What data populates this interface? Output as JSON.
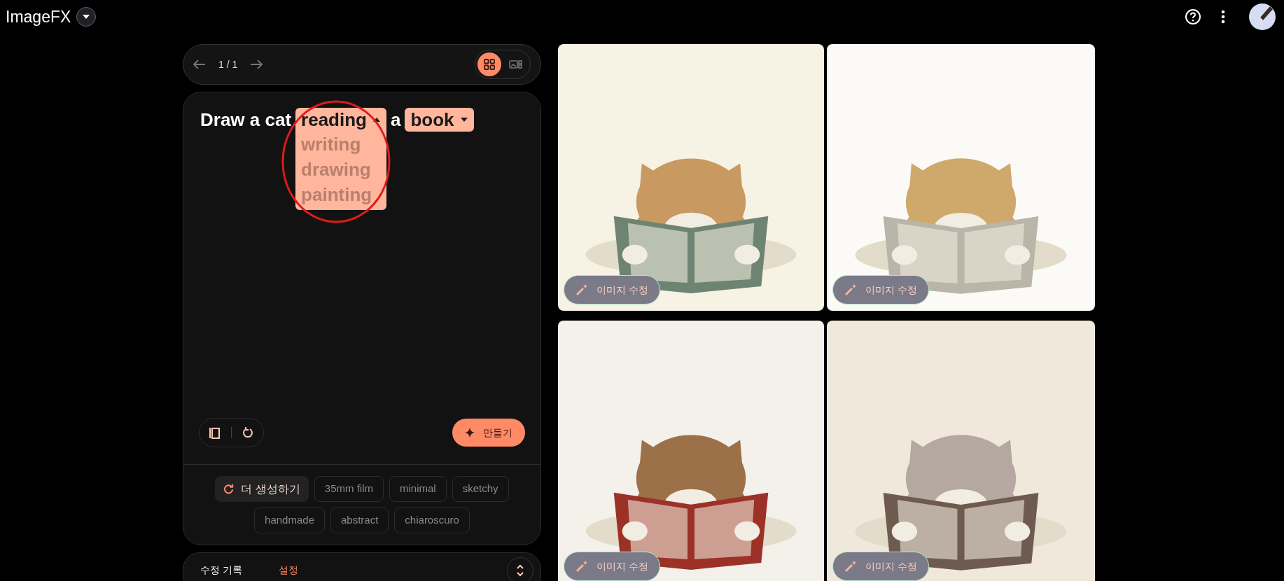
{
  "app": {
    "title": "ImageFX"
  },
  "pager": {
    "label": "1 / 1",
    "views": [
      {
        "kind": "grid",
        "selected": true
      },
      {
        "kind": "single",
        "selected": false
      }
    ]
  },
  "prompt": {
    "segments": [
      {
        "kind": "text",
        "text": "Draw a cat"
      },
      {
        "kind": "chip",
        "text": "reading",
        "expanded": true,
        "options": [
          "writing",
          "drawing",
          "painting"
        ]
      },
      {
        "kind": "text",
        "text": "a"
      },
      {
        "kind": "chip",
        "text": "book",
        "expanded": false
      }
    ]
  },
  "create_button": "만들기",
  "suggestions": [
    {
      "kind": "refresh",
      "label": "더 생성하기"
    },
    {
      "kind": "chip",
      "label": "35mm film"
    },
    {
      "kind": "chip",
      "label": "minimal"
    },
    {
      "kind": "chip",
      "label": "sketchy"
    },
    {
      "kind": "chip",
      "label": "handmade"
    },
    {
      "kind": "chip",
      "label": "abstract"
    },
    {
      "kind": "chip",
      "label": "chiaroscuro"
    }
  ],
  "tabs": [
    {
      "label": "수정 기록",
      "selected": false
    },
    {
      "label": "설정",
      "selected": true
    }
  ],
  "images": [
    {
      "kind": "picture",
      "edit_button": "이미지 수정"
    },
    {
      "kind": "picture",
      "edit_button": "이미지 수정"
    },
    {
      "kind": "picture",
      "edit_button": "이미지 수정"
    },
    {
      "kind": "picture",
      "edit_button": "이미지 수정"
    }
  ],
  "annotation": {
    "kind": "circle",
    "color": "#e01b1b"
  }
}
